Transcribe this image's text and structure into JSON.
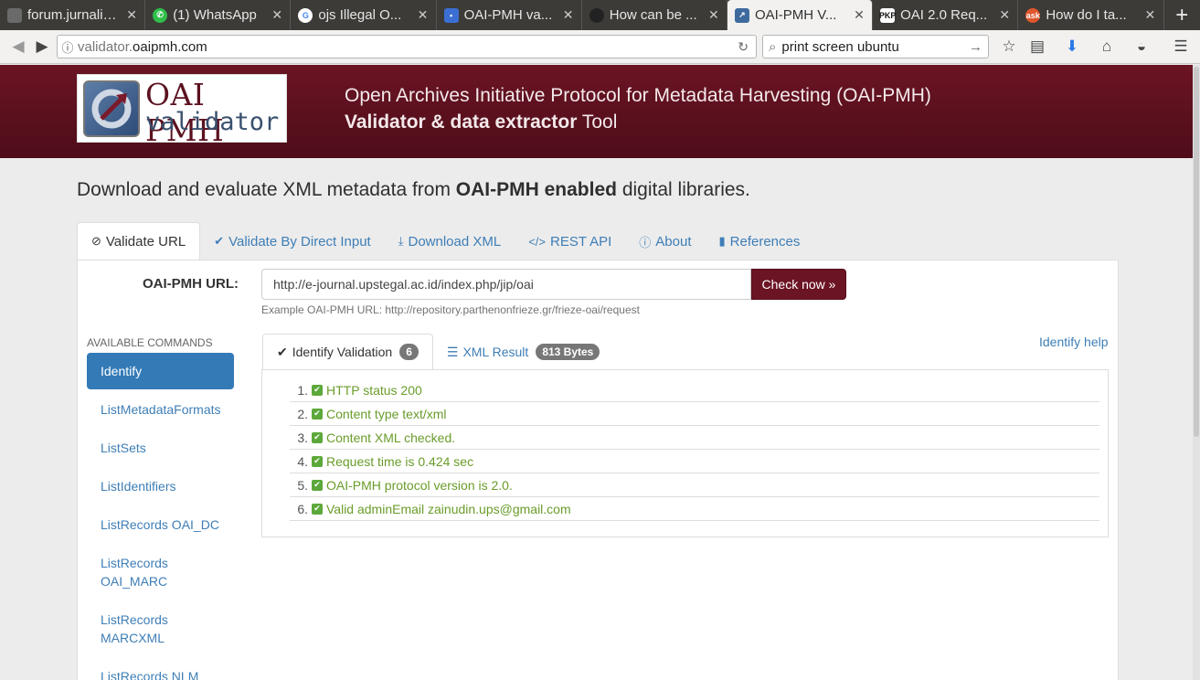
{
  "browser": {
    "tabs": [
      {
        "title": "forum.jurnalin...",
        "favicon": "forum-icon",
        "active": false
      },
      {
        "title": "(1) WhatsApp",
        "favicon": "whatsapp-icon",
        "active": false
      },
      {
        "title": "ojs Illegal O...",
        "favicon": "google-icon",
        "active": false
      },
      {
        "title": "OAI-PMH va...",
        "favicon": "chat-icon",
        "active": false
      },
      {
        "title": "How can be ...",
        "favicon": "github-icon",
        "active": false
      },
      {
        "title": "OAI-PMH V...",
        "favicon": "oai-icon",
        "active": true
      },
      {
        "title": "OAI 2.0 Req...",
        "favicon": "pkp-icon",
        "active": false
      },
      {
        "title": "How do I ta...",
        "favicon": "askubuntu-icon",
        "active": false
      }
    ],
    "url_domain_prefix": "validator.",
    "url_domain_main": "oaipmh.com",
    "search_value": "print screen ubuntu"
  },
  "header": {
    "logo_line1": "OAI PMH",
    "logo_line2": "validator",
    "title": "Open Archives Initiative Protocol for Metadata Harvesting (OAI-PMH)",
    "subtitle_bold": "Validator & data extractor",
    "subtitle_rest": " Tool"
  },
  "lead": {
    "pre": "Download and evaluate XML metadata from ",
    "bold": "OAI-PMH enabled",
    "post": " digital libraries."
  },
  "main_tabs": [
    {
      "label": "Validate URL",
      "icon": "check-circle-icon"
    },
    {
      "label": "Validate By Direct Input",
      "icon": "check-icon"
    },
    {
      "label": "Download XML",
      "icon": "download-icon"
    },
    {
      "label": "REST API",
      "icon": "code-icon"
    },
    {
      "label": "About",
      "icon": "info-icon"
    },
    {
      "label": "References",
      "icon": "bookmark-icon"
    }
  ],
  "form": {
    "label": "OAI-PMH URL:",
    "url_value": "http://e-journal.upstegal.ac.id/index.php/jip/oai",
    "button_label": "Check now »",
    "example": "Example OAI-PMH URL: http://repository.parthenonfrieze.gr/frieze-oai/request"
  },
  "sidebar": {
    "heading": "AVAILABLE COMMANDS",
    "items": [
      {
        "label": "Identify",
        "active": true
      },
      {
        "label": "ListMetadataFormats"
      },
      {
        "label": "ListSets"
      },
      {
        "label": "ListIdentifiers"
      },
      {
        "label": "ListRecords OAI_DC"
      },
      {
        "label": "ListRecords OAI_MARC"
      },
      {
        "label": "ListRecords MARCXML"
      },
      {
        "label": "ListRecords NLM"
      }
    ]
  },
  "results": {
    "tab_validation": "Identify Validation",
    "validation_count": "6",
    "tab_xml": "XML Result",
    "xml_size": "813 Bytes",
    "help": "Identify help",
    "items": [
      "HTTP status 200",
      "Content type text/xml",
      "Content XML checked.",
      "Request time is 0.424 sec",
      "OAI-PMH protocol version is 2.0.",
      "Valid adminEmail zainudin.ups@gmail.com"
    ]
  },
  "colors": {
    "brand": "#6b1424",
    "link": "#3e7eb6",
    "active_nav": "#337ab7",
    "success": "#6a9c2a"
  }
}
